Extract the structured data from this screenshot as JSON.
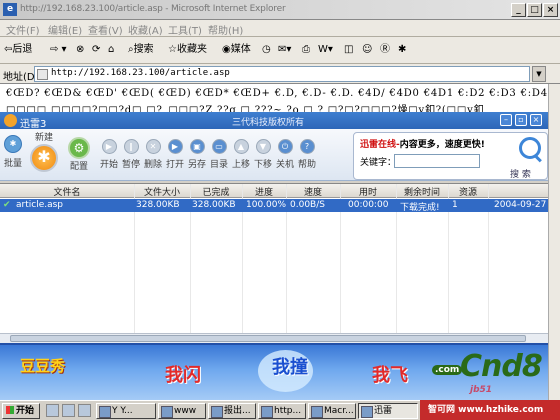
{
  "ie": {
    "title": "http://192.168.23.100/article.asp - Microsoft Internet Explorer",
    "menu": [
      "文件(F)",
      "编辑(E)",
      "查看(V)",
      "收藏(A)",
      "工具(T)",
      "帮助(H)"
    ],
    "toolbar": {
      "back": "后退",
      "search": "搜索",
      "favorites": "收藏夹",
      "media": "媒体"
    },
    "address_label": "地址(D)",
    "address_value": "http://192.168.23.100/article.asp",
    "content_lines": [
      "€ŒD? €ŒD& €ŒD' €ŒD( €ŒD) €ŒD* €ŒD+ €.D, €.D- €.D. €4D/ €4D0 €4D1 €:D2 €:D3 €:D4 €?D@ €? DA €?DB",
      "□□□□ □□□□?□□?d□ □?_□□□?Z ??g □ ???~ ?o □ ? □?□?□□□?燥□y釦?(□□y釦"
    ]
  },
  "xunlei": {
    "title": "迅雷3",
    "copyright": "三代科技版权所有",
    "toolbar": [
      "批量",
      "新建",
      "配置",
      "开始",
      "暂停",
      "删除",
      "打开",
      "另存",
      "目录",
      "上移",
      "下移",
      "关机",
      "帮助"
    ],
    "search": {
      "headline_red": "迅雷在线-",
      "headline_black": "内容更多，速度更快!",
      "keyword_label": "关键字：",
      "search_label": "搜 索"
    },
    "grid": {
      "columns": [
        "文件名",
        "文件大小",
        "已完成",
        "进度",
        "速度",
        "用时",
        "剩余时间",
        "资源",
        ""
      ],
      "rows": [
        {
          "name": "article.asp",
          "size": "328.00KB",
          "done": "328.00KB",
          "progress": "100.00%",
          "speed": "0.00B/S",
          "elapsed": "00:00:00",
          "remaining": "下载完成!",
          "sources": "1",
          "date": "2004-09-27"
        }
      ]
    },
    "banner": {
      "word1": "我闪",
      "word2": "我撞",
      "word3": "我飞",
      "com": ".com",
      "brand": "Cnd8",
      "handwriting": "jb51"
    }
  },
  "taskbar": {
    "start": "开始",
    "tasks": [
      "Y Y...",
      "www",
      "报出...",
      "http...",
      "Macr...",
      "迅雷"
    ]
  },
  "watermark": "智可网 www.hzhike.com",
  "colors": {
    "selection": "#316ac5",
    "xunlei_title": "#2d66b8",
    "accent_red": "#d01010"
  }
}
